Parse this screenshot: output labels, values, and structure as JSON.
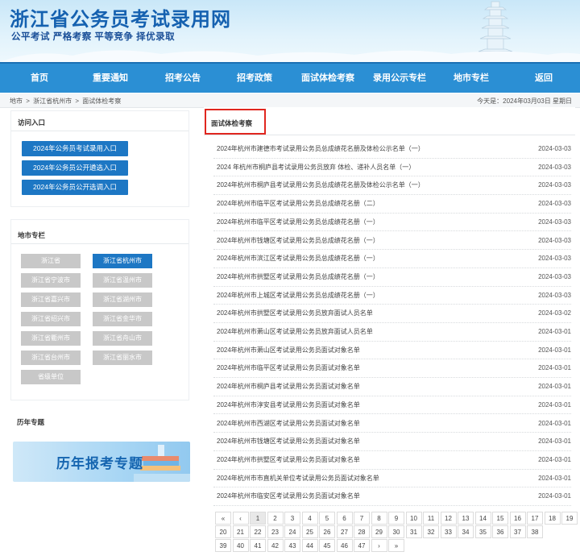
{
  "site": {
    "title": "浙江省公务员考试录用网",
    "slogan": "公平考试 严格考察 平等竞争 择优录取"
  },
  "nav": [
    "首页",
    "重要通知",
    "招考公告",
    "招考政策",
    "面试体检考察",
    "录用公示专栏",
    "地市专栏",
    "返回"
  ],
  "breadcrumb": [
    "地市",
    ">",
    "浙江省杭州市",
    ">",
    "面试体检考察"
  ],
  "date_text": "今天是：2024年03月03日 星期日",
  "access": {
    "title": "访问入口",
    "buttons": [
      "2024年公务员考试录用入口",
      "2024年公务员公开遴选入口",
      "2024年公务员公开选调入口"
    ]
  },
  "cities": {
    "title": "地市专栏",
    "items": [
      "浙江省",
      "浙江省杭州市",
      "浙江省宁波市",
      "浙江省温州市",
      "浙江省嘉兴市",
      "浙江省湖州市",
      "浙江省绍兴市",
      "浙江省金华市",
      "浙江省衢州市",
      "浙江省舟山市",
      "浙江省台州市",
      "浙江省丽水市",
      "省级单位"
    ],
    "active_index": 1
  },
  "history": {
    "title": "历年专题",
    "banner_text": "历年报考专题"
  },
  "main": {
    "section_title": "面试体检考察",
    "rows": [
      {
        "title": "2024年杭州市建德市考试录用公务员总成绩花名册及体检公示名单（一）",
        "date": "2024-03-03"
      },
      {
        "title": "2024 年杭州市桐庐县考试录用公务员放弃 体检、递补人员名单（一）",
        "date": "2024-03-03"
      },
      {
        "title": "2024年杭州市桐庐县考试录用公务员总成绩花名册及体检公示名单（一）",
        "date": "2024-03-03"
      },
      {
        "title": "2024年杭州市临平区考试录用公务员总成绩花名册（二）",
        "date": "2024-03-03"
      },
      {
        "title": "2024年杭州市临平区考试录用公务员总成绩花名册（一）",
        "date": "2024-03-03"
      },
      {
        "title": "2024年杭州市钱塘区考试录用公务员总成绩花名册（一）",
        "date": "2024-03-03"
      },
      {
        "title": "2024年杭州市滨江区考试录用公务员总成绩花名册（一）",
        "date": "2024-03-03"
      },
      {
        "title": "2024年杭州市拱墅区考试录用公务员总成绩花名册（一）",
        "date": "2024-03-03"
      },
      {
        "title": "2024年杭州市上城区考试录用公务员总成绩花名册（一）",
        "date": "2024-03-03"
      },
      {
        "title": "2024年杭州市拱墅区考试录用公务员放弃面试人员名单",
        "date": "2024-03-02"
      },
      {
        "title": "2024年杭州市萧山区考试录用公务员放弃面试人员名单",
        "date": "2024-03-01"
      },
      {
        "title": "2024年杭州市萧山区考试录用公务员面试对象名单",
        "date": "2024-03-01"
      },
      {
        "title": "2024年杭州市临平区考试录用公务员面试对象名单",
        "date": "2024-03-01"
      },
      {
        "title": "2024年杭州市桐庐县考试录用公务员面试对象名单",
        "date": "2024-03-01"
      },
      {
        "title": "2024年杭州市淳安县考试录用公务员面试对象名单",
        "date": "2024-03-01"
      },
      {
        "title": "2024年杭州市西湖区考试录用公务员面试对象名单",
        "date": "2024-03-01"
      },
      {
        "title": "2024年杭州市钱塘区考试录用公务员面试对象名单",
        "date": "2024-03-01"
      },
      {
        "title": "2024年杭州市拱墅区考试录用公务员面试对象名单",
        "date": "2024-03-01"
      },
      {
        "title": "2024年杭州市市直机关单位考试录用公务员面试对象名单",
        "date": "2024-03-01"
      },
      {
        "title": "2024年杭州市临安区考试录用公务员面试对象名单",
        "date": "2024-03-01"
      }
    ]
  },
  "pagination": {
    "items": [
      "«",
      "‹",
      "1",
      "2",
      "3",
      "4",
      "5",
      "6",
      "7",
      "8",
      "9",
      "10",
      "11",
      "12",
      "13",
      "14",
      "15",
      "16",
      "17",
      "18",
      "19",
      "20",
      "21",
      "22",
      "23",
      "24",
      "25",
      "26",
      "27",
      "28",
      "29",
      "30",
      "31",
      "32",
      "33",
      "34",
      "35",
      "36",
      "37",
      "38",
      "39",
      "40",
      "41",
      "42",
      "43",
      "44",
      "45",
      "46",
      "47",
      "›",
      "»"
    ],
    "current": "1"
  }
}
